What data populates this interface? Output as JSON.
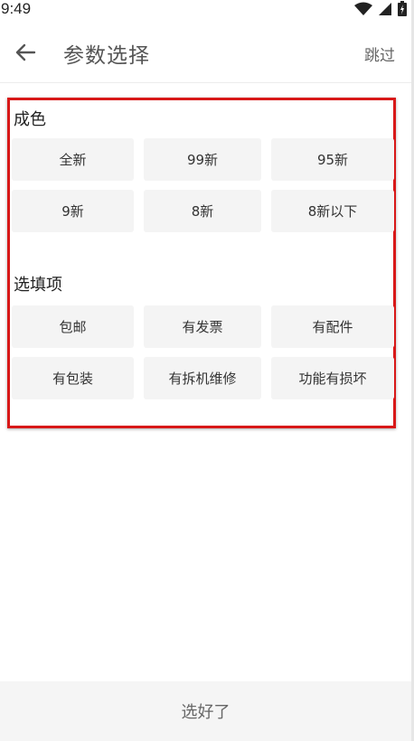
{
  "status_bar": {
    "time": "9:49",
    "icons": [
      "wifi-icon",
      "signal-icon",
      "battery-icon"
    ]
  },
  "toolbar": {
    "back_icon": "arrow-left-icon",
    "title": "参数选择",
    "skip_label": "跳过"
  },
  "sections": [
    {
      "title": "成色",
      "options": [
        "全新",
        "99新",
        "95新",
        "9新",
        "8新",
        "8新以下"
      ]
    },
    {
      "title": "选填项",
      "options": [
        "包邮",
        "有发票",
        "有配件",
        "有包装",
        "有拆机维修",
        "功能有损坏"
      ]
    }
  ],
  "bottom": {
    "confirm_label": "选好了"
  },
  "colors": {
    "highlight_border": "#d81818",
    "option_bg": "#f4f4f4",
    "bottom_bg": "#f5f5f5"
  }
}
